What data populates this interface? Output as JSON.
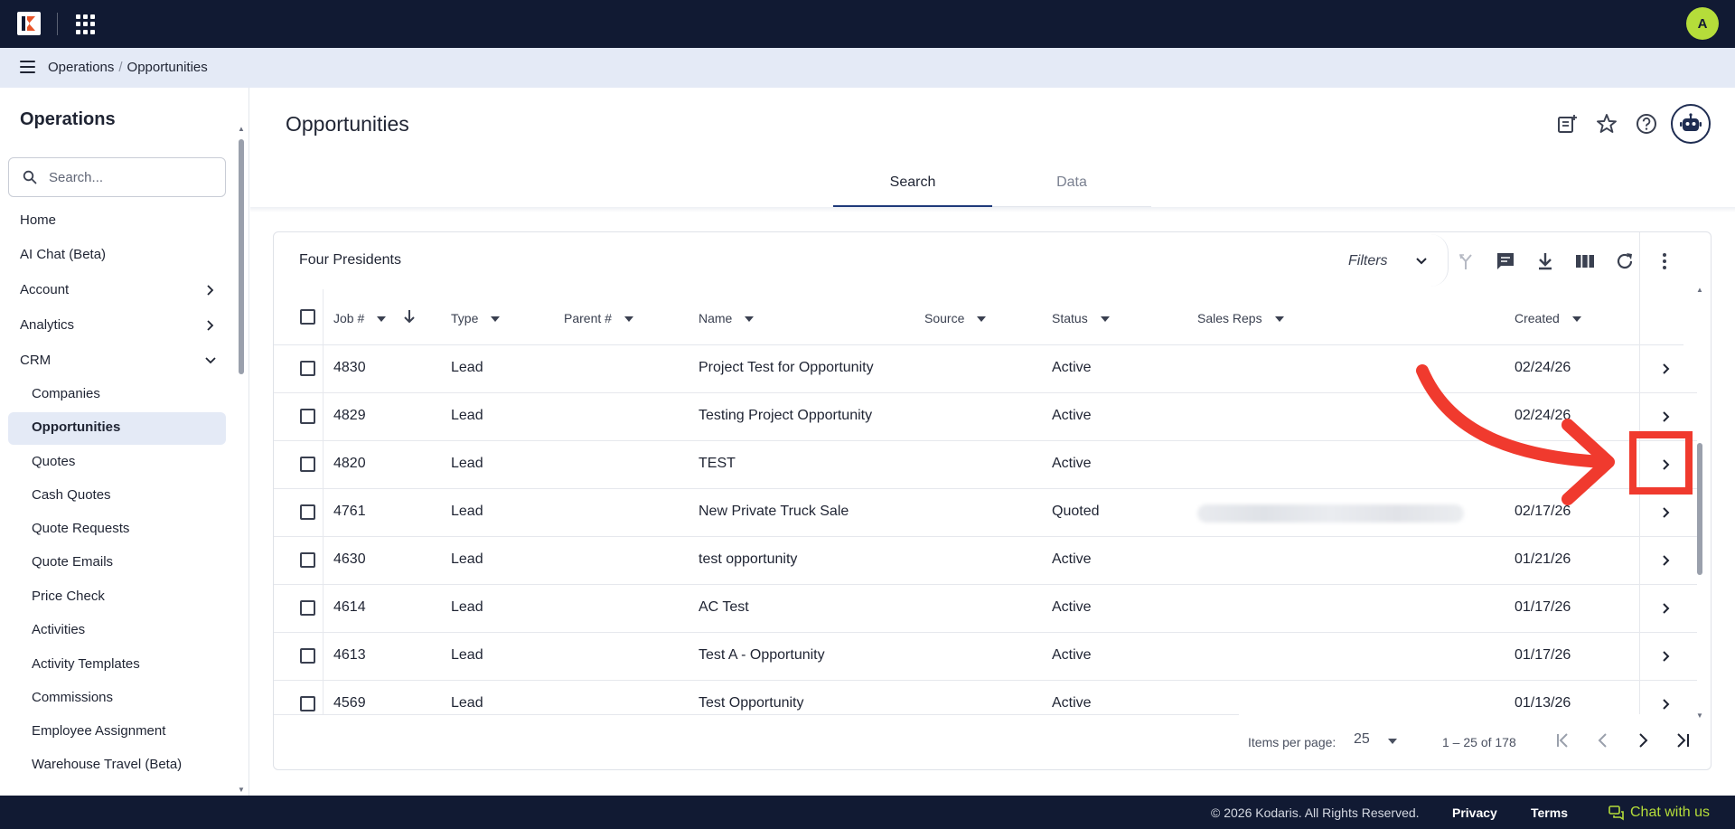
{
  "topbar": {
    "avatar_initial": "A"
  },
  "breadcrumb": {
    "items": [
      "Operations",
      "Opportunities"
    ],
    "separator": "/"
  },
  "sidebar": {
    "title": "Operations",
    "search_placeholder": "Search...",
    "items": [
      {
        "label": "Home"
      },
      {
        "label": "AI Chat (Beta)"
      },
      {
        "label": "Account",
        "chevron": "chevron-right"
      },
      {
        "label": "Analytics",
        "chevron": "chevron-right"
      },
      {
        "label": "CRM",
        "chevron": "chevron-down"
      }
    ],
    "crm_children": [
      "Companies",
      "Opportunities",
      "Quotes",
      "Cash Quotes",
      "Quote Requests",
      "Quote Emails",
      "Price Check",
      "Activities",
      "Activity Templates",
      "Commissions",
      "Employee Assignment",
      "Warehouse Travel (Beta)"
    ],
    "active_child": "Opportunities"
  },
  "main": {
    "title": "Opportunities",
    "tabs": [
      {
        "label": "Search",
        "active": true
      },
      {
        "label": "Data",
        "active": false
      }
    ],
    "header_icons": [
      "add-note-icon",
      "star-icon",
      "help-icon",
      "robot-icon"
    ]
  },
  "card": {
    "title": "Four Presidents",
    "filters_label": "Filters",
    "toolbar_icons": [
      "merge-icon",
      "comment-icon",
      "download-icon",
      "columns-icon",
      "refresh-icon",
      "more-vert-icon"
    ]
  },
  "table": {
    "columns": [
      "Job #",
      "Type",
      "Parent #",
      "Name",
      "Source",
      "Status",
      "Sales Reps",
      "Created"
    ],
    "rows": [
      {
        "job": "4830",
        "type": "Lead",
        "parent": "",
        "name": "Project Test for Opportunity",
        "source": "",
        "status": "Active",
        "sales_reps": "",
        "created": "02/24/26"
      },
      {
        "job": "4829",
        "type": "Lead",
        "parent": "",
        "name": "Testing Project Opportunity",
        "source": "",
        "status": "Active",
        "sales_reps": "",
        "created": "02/24/26"
      },
      {
        "job": "4820",
        "type": "Lead",
        "parent": "",
        "name": "TEST",
        "source": "",
        "status": "Active",
        "sales_reps": "",
        "created": ""
      },
      {
        "job": "4761",
        "type": "Lead",
        "parent": "",
        "name": "New Private Truck Sale",
        "source": "",
        "status": "Quoted",
        "sales_reps": "",
        "sales_reps_blurred": true,
        "created": "02/17/26"
      },
      {
        "job": "4630",
        "type": "Lead",
        "parent": "",
        "name": "test opportunity",
        "source": "",
        "status": "Active",
        "sales_reps": "",
        "created": "01/21/26"
      },
      {
        "job": "4614",
        "type": "Lead",
        "parent": "",
        "name": "AC Test",
        "source": "",
        "status": "Active",
        "sales_reps": "",
        "created": "01/17/26"
      },
      {
        "job": "4613",
        "type": "Lead",
        "parent": "",
        "name": "Test A - Opportunity",
        "source": "",
        "status": "Active",
        "sales_reps": "",
        "created": "01/17/26"
      },
      {
        "job": "4569",
        "type": "Lead",
        "parent": "",
        "name": "Test Opportunity",
        "source": "",
        "status": "Active",
        "sales_reps": "",
        "created": "01/13/26"
      }
    ]
  },
  "pager": {
    "items_per_page_label": "Items per page:",
    "items_per_page": "25",
    "range": "1 – 25 of 178"
  },
  "annotation": {
    "color": "#f03a2e",
    "highlight_row_index": 2
  },
  "footer": {
    "copyright": "© 2026 Kodaris. All Rights Reserved.",
    "privacy": "Privacy",
    "terms": "Terms",
    "chat": "Chat with us"
  },
  "colors": {
    "navy": "#111a33",
    "accent_green": "#b5dd3a",
    "crumb_bg": "#e4eaf6"
  }
}
